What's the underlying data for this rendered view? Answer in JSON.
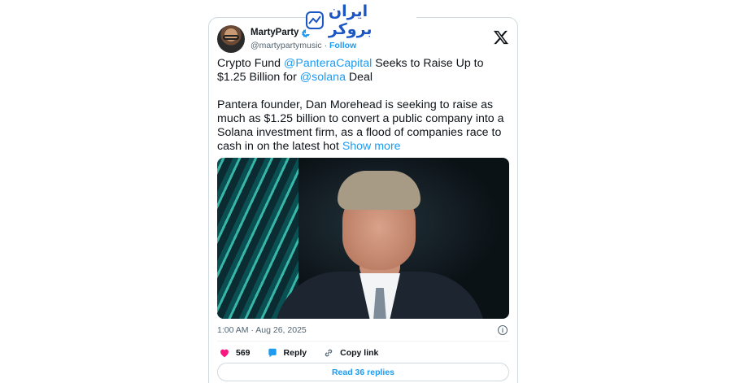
{
  "watermark": {
    "text": "ایران بروکر"
  },
  "tweet": {
    "author_name": "MartyParty",
    "author_handle": "@martypartymusic",
    "separator": "·",
    "follow_label": "Follow",
    "text_line1_a": "Crypto Fund ",
    "mention_1": "@PanteraCapital",
    "text_line1_b": " Seeks to Raise Up to $1.25 Billion for ",
    "mention_2": "@solana",
    "text_line1_c": "  Deal",
    "paragraph_2": "Pantera founder, Dan Morehead is seeking to raise as much as $1.25 billion to convert a public company into a Solana investment firm, as a flood of companies race to cash in on the latest hot ",
    "show_more_label": "Show more",
    "timestamp": "1:00 AM · Aug 26, 2025",
    "likes_count": "569",
    "reply_label": "Reply",
    "copy_link_label": "Copy link",
    "read_replies_label": "Read 36 replies"
  },
  "icons": {
    "verified": "verified-badge-icon",
    "x": "x-logo-icon",
    "info": "info-icon",
    "heart": "heart-icon",
    "reply": "reply-icon",
    "link": "link-icon"
  },
  "colors": {
    "accent": "#1d9bf0",
    "heart": "#f91880",
    "muted": "#536471",
    "watermark": "#1a56c4"
  }
}
